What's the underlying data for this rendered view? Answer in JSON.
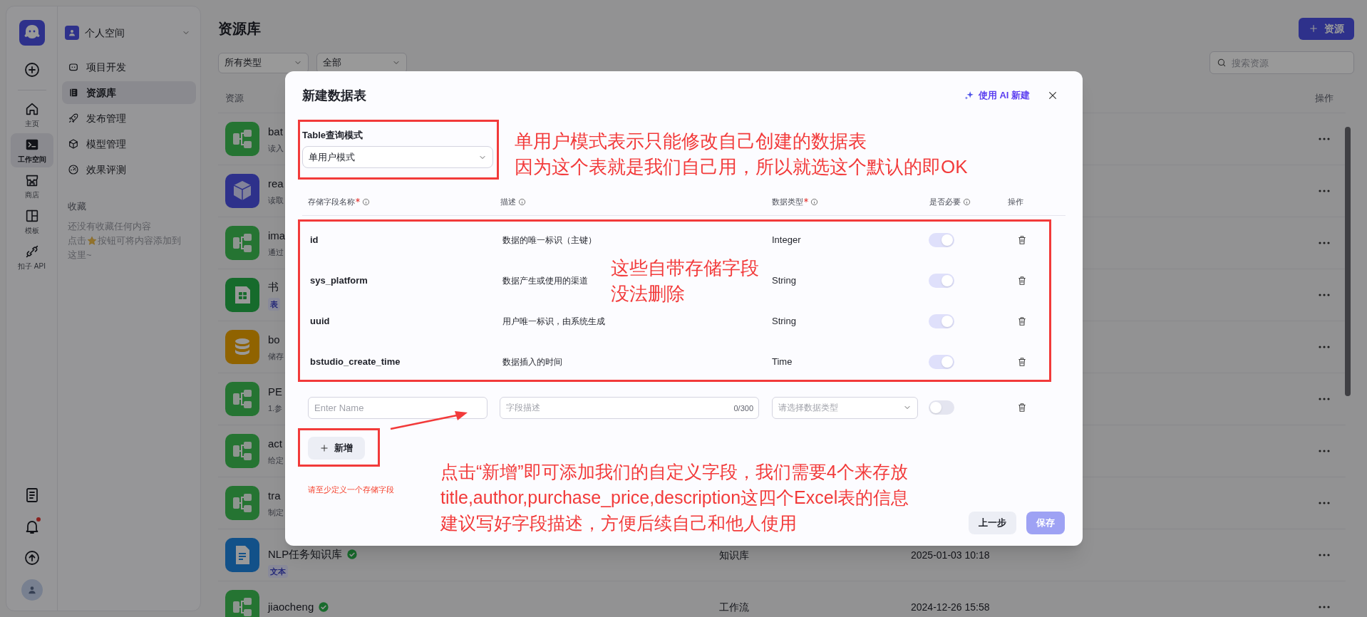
{
  "rail": {
    "items": [
      {
        "label": "主页",
        "kind": "home",
        "selected": false
      },
      {
        "label": "工作空间",
        "kind": "workspace",
        "selected": true
      },
      {
        "label": "商店",
        "kind": "store",
        "selected": false
      },
      {
        "label": "模板",
        "kind": "template",
        "selected": false
      },
      {
        "label": "扣子 API",
        "kind": "api",
        "selected": false
      }
    ],
    "bottom": [
      {
        "kind": "docs",
        "badge": false
      },
      {
        "kind": "bell",
        "badge": true
      },
      {
        "kind": "upload",
        "badge": false
      }
    ]
  },
  "workspace": {
    "name": "个人空间"
  },
  "nav": [
    {
      "label": "项目开发",
      "kind": "project",
      "selected": false
    },
    {
      "label": "资源库",
      "kind": "library",
      "selected": true
    },
    {
      "label": "发布管理",
      "kind": "publish",
      "selected": false
    },
    {
      "label": "模型管理",
      "kind": "model",
      "selected": false
    },
    {
      "label": "效果评测",
      "kind": "eval",
      "selected": false
    }
  ],
  "favorites": {
    "title": "收藏",
    "empty_text": "还没有收藏任何内容",
    "hint_before": "点击",
    "hint_after": "按钮可将内容添加到",
    "hint_end": "这里~"
  },
  "page": {
    "title": "资源库",
    "add_button": "资源",
    "filters": [
      "所有类型",
      "全部"
    ],
    "search": {
      "placeholder": "搜索资源"
    }
  },
  "table": {
    "columns": [
      "资源",
      "操作"
    ],
    "rows": [
      {
        "kind": "workflow",
        "name": "bat",
        "description": "读入"
      },
      {
        "kind": "plugin",
        "name": "rea",
        "description": "读取"
      },
      {
        "kind": "workflow",
        "name": "ima",
        "description": "通过"
      },
      {
        "kind": "sheet",
        "name": "书",
        "tag": "表"
      },
      {
        "kind": "database",
        "name": "bo",
        "description": "储存"
      },
      {
        "kind": "workflow",
        "name": "PE",
        "description": "1.参"
      },
      {
        "kind": "workflow",
        "name": "act",
        "description": "给定"
      },
      {
        "kind": "workflow",
        "name": "tra",
        "description": "制定"
      },
      {
        "kind": "knowledge",
        "name": "NLP任务知识库",
        "verified": true,
        "tag": "文本",
        "type": "知识库",
        "date": "2025-01-03 10:18"
      },
      {
        "kind": "workflow",
        "name": "jiaocheng",
        "verified": true,
        "type": "工作流",
        "date": "2024-12-26 15:58"
      }
    ]
  },
  "dialog": {
    "title": "新建数据表",
    "ai_button": "使用 AI 新建",
    "query_mode": {
      "label": "Table查询模式",
      "value": "单用户模式"
    },
    "columns": [
      {
        "label": "存储字段名称",
        "required": true,
        "info": true
      },
      {
        "label": "描述",
        "required": false,
        "info": true
      },
      {
        "label": "数据类型",
        "required": true,
        "info": true
      },
      {
        "label": "是否必要",
        "required": false,
        "info": true
      },
      {
        "label": "操作",
        "required": false,
        "info": false
      }
    ],
    "fields": [
      {
        "name": "id",
        "description": "数据的唯一标识（主键）",
        "type": "Integer",
        "required": true
      },
      {
        "name": "sys_platform",
        "description": "数据产生或使用的渠道",
        "type": "String",
        "required": true
      },
      {
        "name": "uuid",
        "description": "用户唯一标识，由系统生成",
        "type": "String",
        "required": true
      },
      {
        "name": "bstudio_create_time",
        "description": "数据插入的时间",
        "type": "Time",
        "required": true
      }
    ],
    "new_field": {
      "name_placeholder": "Enter Name",
      "description_placeholder": "字段描述",
      "counter": "0/300",
      "type_placeholder": "请选择数据类型",
      "required": false
    },
    "add_button": "新增",
    "error": "请至少定义一个存储字段",
    "buttons": [
      {
        "label": "上一步",
        "disabled": false
      },
      {
        "label": "保存",
        "disabled": true
      }
    ]
  },
  "annotations": [
    {
      "lines": [
        "单用户模式表示只能修改自己创建的数据表",
        "因为这个表就是我们自己用，所以就选这个默认的即OK"
      ]
    },
    {
      "lines": [
        "这些自带存储字段",
        "没法删除"
      ]
    },
    {
      "lines": [
        "点击“新增”即可添加我们的自定义字段，我们需要4个来存放",
        "title,author,purchase_price,description这四个Excel表的信息",
        "建议写好字段描述，方便后续自己和他人使用"
      ]
    }
  ]
}
